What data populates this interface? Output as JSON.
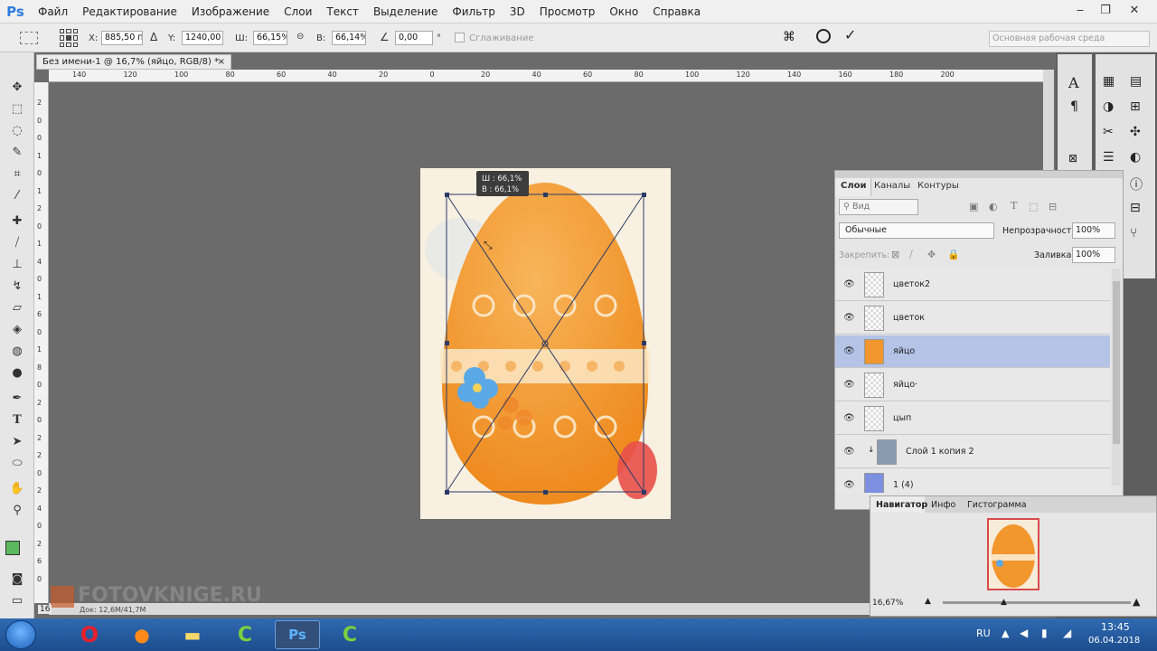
{
  "app": {
    "logo": "Ps"
  },
  "menu": [
    "Файл",
    "Редактирование",
    "Изображение",
    "Слои",
    "Текст",
    "Выделение",
    "Фильтр",
    "3D",
    "Просмотр",
    "Окно",
    "Справка"
  ],
  "window_controls": {
    "minimize_icon": "minimize-icon",
    "restore_icon": "restore-icon",
    "close_icon": "close-icon"
  },
  "options": {
    "x_label": "X:",
    "x_value": "885,50 пи",
    "y_label": "Y:",
    "y_value": "1240,00 п",
    "w_label": "Ш:",
    "w_value": "66,15%",
    "h_label": "В:",
    "h_value": "66,14%",
    "angle_value": "0,00",
    "angle_unit": "°",
    "antialias_label": "Сглаживание",
    "workspace": "Основная рабочая среда"
  },
  "document": {
    "tab_title": "Без имени-1 @ 16,7% (яйцо, RGB/8) *",
    "tab_close": "×"
  },
  "ruler": {
    "h_ticks": [
      "140",
      "120",
      "100",
      "80",
      "60",
      "40",
      "20",
      "0",
      "20",
      "40",
      "60",
      "80",
      "100",
      "120",
      "140",
      "160",
      "180",
      "200"
    ],
    "v_ticks": [
      "2",
      "0",
      "0",
      "1",
      "0",
      "1",
      "2",
      "0",
      "1",
      "4",
      "0",
      "1",
      "6",
      "0",
      "1",
      "8",
      "0",
      "2",
      "0",
      "2",
      "2",
      "0",
      "2",
      "4",
      "0",
      "2",
      "6",
      "0"
    ]
  },
  "transform_tooltip": {
    "line1": "Ш : 66,1%",
    "line2": "В : 66,1%"
  },
  "status": {
    "doc": "Док: 12,6M/41,7M",
    "zoom_field": "16"
  },
  "watermark": "FOTOVKNIGE.RU",
  "layers_panel": {
    "tabs": [
      "Слои",
      "Каналы",
      "Контуры"
    ],
    "search_placeholder": "Вид",
    "blend_mode": "Обычные",
    "opacity_label": "Непрозрачность:",
    "opacity_value": "100%",
    "lock_label": "Закрепить:",
    "fill_label": "Заливка:",
    "fill_value": "100%",
    "layers": [
      {
        "name": "цветок2",
        "selected": false
      },
      {
        "name": "цветок",
        "selected": false
      },
      {
        "name": "яйцо",
        "selected": true
      },
      {
        "name": "яйцо·",
        "selected": false
      },
      {
        "name": "цып",
        "selected": false
      },
      {
        "name": "Слой 1 копия 2",
        "selected": false
      },
      {
        "name": "1 (4)",
        "selected": false
      }
    ]
  },
  "navigator": {
    "tabs": [
      "Навигатор",
      "Инфо",
      "Гистограмма"
    ],
    "zoom": "16,67%"
  },
  "taskbar": {
    "lang": "RU",
    "time": "13:45",
    "date": "06.04.2018",
    "apps": [
      "opera-icon",
      "firefox-icon",
      "explorer-icon",
      "camtasia-icon",
      "photoshop-icon",
      "camtasia-recorder-icon"
    ]
  },
  "colors": {
    "accent": "#3476c8",
    "egg": "#f2962e",
    "selected_layer": "#b4c3e6"
  }
}
